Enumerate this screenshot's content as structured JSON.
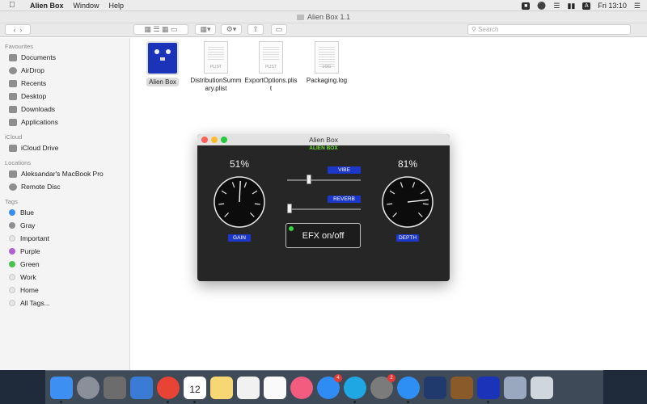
{
  "menubar": {
    "app_name": "Alien Box",
    "items": [
      "Window",
      "Help"
    ],
    "clock": "Fri 13:10",
    "input_source": "A"
  },
  "finder": {
    "window_title": "Alien Box 1.1",
    "search_placeholder": "Search",
    "sidebar": {
      "favourites_header": "Favourites",
      "favourites": [
        {
          "label": "Documents",
          "icon": "documents-icon"
        },
        {
          "label": "AirDrop",
          "icon": "airdrop-icon"
        },
        {
          "label": "Recents",
          "icon": "recents-icon"
        },
        {
          "label": "Desktop",
          "icon": "desktop-icon"
        },
        {
          "label": "Downloads",
          "icon": "downloads-icon"
        },
        {
          "label": "Applications",
          "icon": "applications-icon"
        }
      ],
      "icloud_header": "iCloud",
      "icloud": [
        {
          "label": "iCloud Drive",
          "icon": "cloud-icon"
        }
      ],
      "locations_header": "Locations",
      "locations": [
        {
          "label": "Aleksandar's MacBook Pro",
          "icon": "laptop-icon"
        },
        {
          "label": "Remote Disc",
          "icon": "disc-icon"
        }
      ],
      "tags_header": "Tags",
      "tags": [
        {
          "label": "Blue",
          "color": "#3b8df0"
        },
        {
          "label": "Gray",
          "color": "#8e8e93"
        },
        {
          "label": "Important",
          "color": "#e6e6e6"
        },
        {
          "label": "Purple",
          "color": "#b061d0"
        },
        {
          "label": "Green",
          "color": "#4cc14f"
        },
        {
          "label": "Work",
          "color": "#e6e6e6"
        },
        {
          "label": "Home",
          "color": "#e6e6e6"
        },
        {
          "label": "All Tags...",
          "color": "#e6e6e6"
        }
      ]
    },
    "files": [
      {
        "name": "Alien Box",
        "kind": "app"
      },
      {
        "name": "DistributionSummary.plist",
        "kind": "plist",
        "tag": "PLIST"
      },
      {
        "name": "ExportOptions.plist",
        "kind": "plist",
        "tag": "PLIST"
      },
      {
        "name": "Packaging.log",
        "kind": "log",
        "tag": "LOG"
      }
    ]
  },
  "alienbox": {
    "window_title": "Alien Box",
    "brand": "ALIEN BOX",
    "gain": {
      "label": "GAIN",
      "value_text": "51%",
      "value": 0.51
    },
    "depth": {
      "label": "DEPTH",
      "value_text": "81%",
      "value": 0.81
    },
    "vibe": {
      "label": "VIBE",
      "value": 0.3
    },
    "reverb": {
      "label": "REVERB",
      "value": 0.0
    },
    "efx": {
      "label": "EFX on/off",
      "enabled": true
    },
    "colors": {
      "label_bg": "#1d38c8",
      "brand": "#6fe23a",
      "led": "#35d43a"
    }
  },
  "dock": {
    "apps": [
      {
        "name": "finder-icon",
        "color": "#3d8ff2",
        "running": true
      },
      {
        "name": "launchpad-icon",
        "color": "#8a8f99"
      },
      {
        "name": "calculator-icon",
        "color": "#6c6c6c"
      },
      {
        "name": "xcode-instruments-icon",
        "color": "#3a7bd5"
      },
      {
        "name": "chrome-icon",
        "color": "#e84335",
        "running": true
      },
      {
        "name": "calendar-icon",
        "color": "#ffffff",
        "text": "12",
        "running": true
      },
      {
        "name": "notes-icon",
        "color": "#f7d774"
      },
      {
        "name": "textedit-icon",
        "color": "#f1f1f1"
      },
      {
        "name": "reminders-icon",
        "color": "#fafafa"
      },
      {
        "name": "itunes-icon",
        "color": "#f35b7f"
      },
      {
        "name": "app-store-icon",
        "color": "#2f8cf5",
        "badge": "4"
      },
      {
        "name": "skype-icon",
        "color": "#1fa7e4",
        "running": true
      },
      {
        "name": "system-preferences-icon",
        "color": "#7b7b7b",
        "badge": "2"
      },
      {
        "name": "safari-icon",
        "color": "#2d8ff3",
        "running": true
      },
      {
        "name": "instruments-icon",
        "color": "#203a6d"
      },
      {
        "name": "guitar-icon",
        "color": "#8a5a2b"
      },
      {
        "name": "alien-box-icon",
        "color": "#1b33b8",
        "running": true
      },
      {
        "name": "downloads-stack-icon",
        "color": "#9aa8bf"
      },
      {
        "name": "trash-icon",
        "color": "#cfd6de"
      }
    ]
  }
}
